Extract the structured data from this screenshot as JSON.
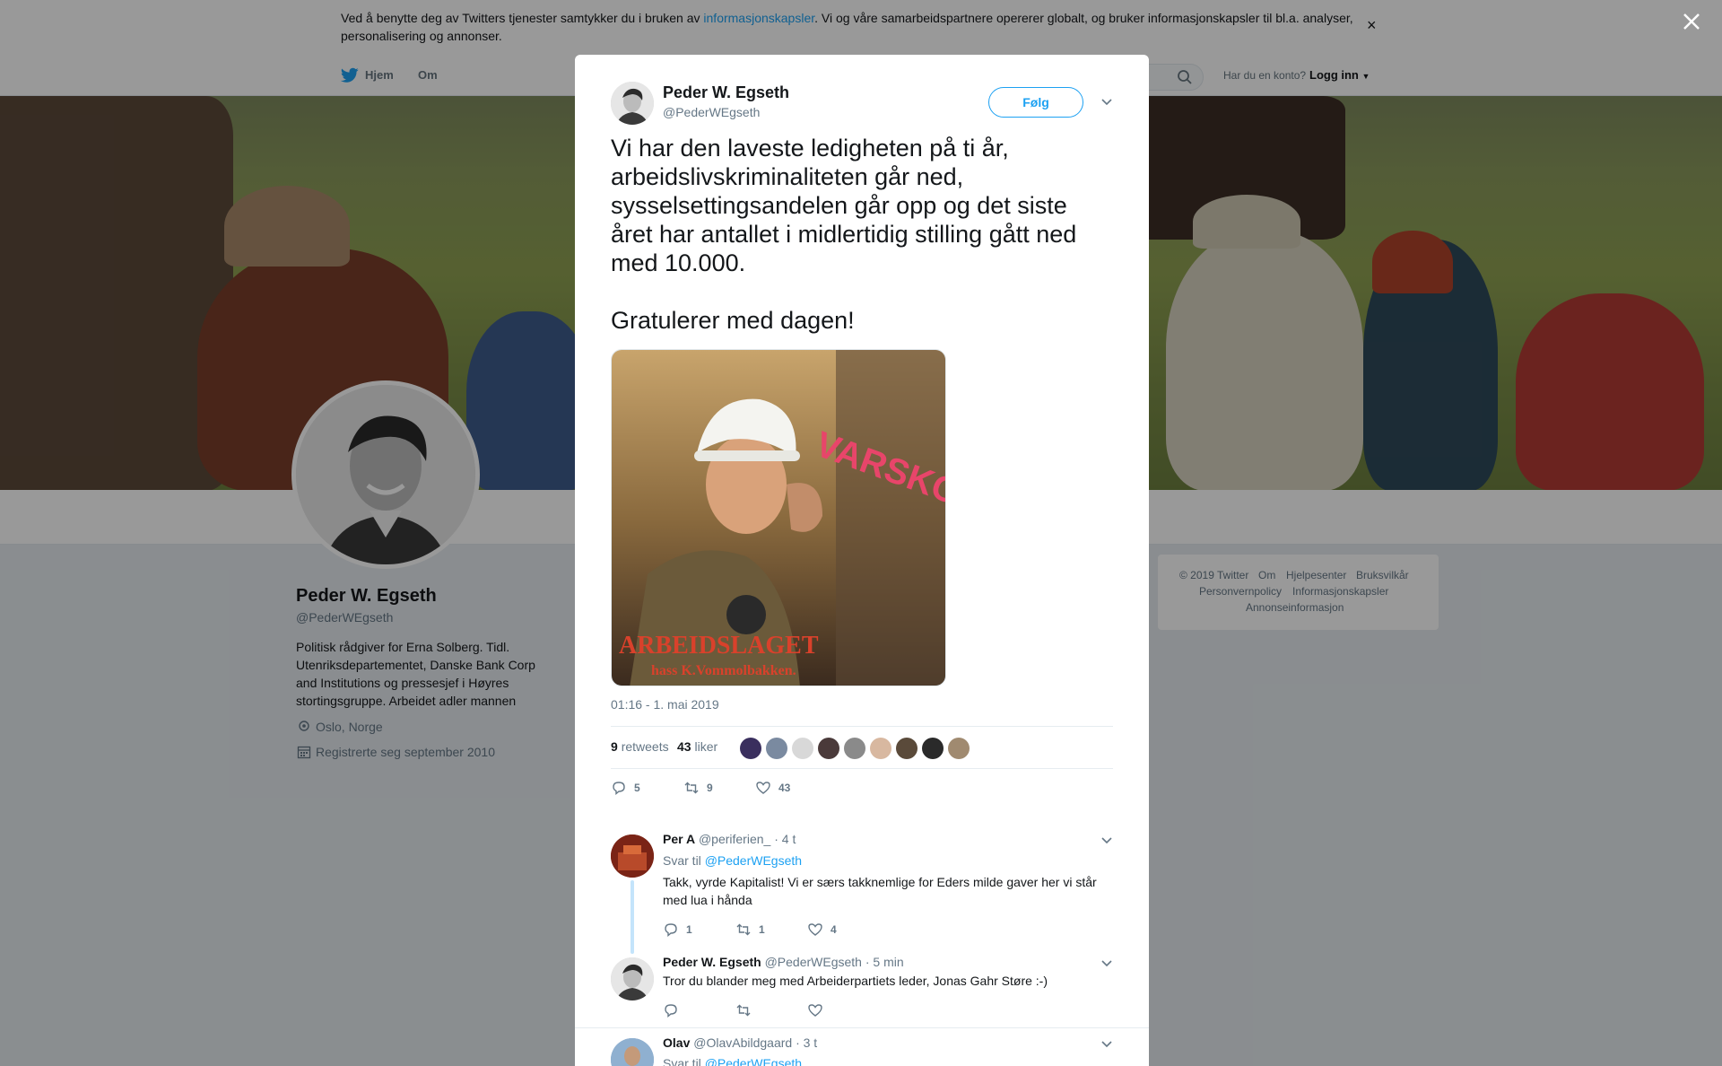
{
  "cookie": {
    "text_before": "Ved å benytte deg av Twitters tjenester samtykker du i bruken av ",
    "link": "informasjonskapsler",
    "text_after": ". Vi og våre samarbeidspartnere opererer globalt, og bruker informasjonskapsler til bl.a. analyser, personalisering og annonser.",
    "close": "×"
  },
  "nav": {
    "home": "Hjem",
    "about": "Om",
    "account_question": "Har du en konto?",
    "login": "Logg inn"
  },
  "profile": {
    "name": "Peder W. Egseth",
    "handle": "@PederWEgseth",
    "bio": "Politisk rådgiver for Erna Solberg. Tidl. Utenriksdepartementet, Danske Bank Corp and Institutions og pressesjef i Høyres stortingsgruppe. Arbeidet adler mannen",
    "location": "Oslo, Norge",
    "joined": "Registrerte seg september 2010"
  },
  "footer": {
    "copyright": "© 2019 Twitter",
    "about": "Om",
    "help": "Hjelpesenter",
    "terms": "Bruksvilkår",
    "privacy": "Personvernpolicy",
    "cookies": "Informasjonskapsler",
    "ads": "Annonseinformasjon"
  },
  "tweet": {
    "name": "Peder W. Egseth",
    "handle": "@PederWEgseth",
    "follow": "Følg",
    "text": "Vi har den laveste ledigheten på ti år, arbeidslivskriminaliteten går ned, sysselsettingsandelen går opp og det siste året har antallet i midlertidig stilling gått ned med 10.000.\n\nGratulerer med dagen!",
    "timestamp": "01:16 - 1. mai 2019",
    "retweets_count": "9",
    "retweets_label": "retweets",
    "likes_count": "43",
    "likes_label": "liker",
    "replies": "5",
    "retweets": "9",
    "likes": "43",
    "image": {
      "headline": "VARSKO HER!",
      "title": "ARBEIDSLAGET",
      "subtitle": "hass K.Vommolbakken."
    }
  },
  "replies": [
    {
      "name": "Per A",
      "handle": "@periferien_",
      "time": "· 4 t",
      "reply_to_label": "Svar til",
      "reply_to": "@PederWEgseth",
      "text": "Takk, vyrde Kapitalist! Vi er særs takknemlige for Eders milde gaver her vi står med lua i hånda",
      "replies": "1",
      "retweets": "1",
      "likes": "4"
    },
    {
      "name": "Peder W. Egseth",
      "handle": "@PederWEgseth",
      "time": "· 5 min",
      "text": "Tror du blander meg med Arbeiderpartiets leder, Jonas Gahr Støre :-)"
    },
    {
      "name": "Olav",
      "handle": "@OlavAbildgaard",
      "time": "· 3 t",
      "reply_to_label": "Svar til",
      "reply_to": "@PederWEgseth"
    }
  ],
  "colors": {
    "accent": "#1da1f2",
    "text_primary": "#14171a",
    "text_secondary": "#657786",
    "overlay": "rgba(0,0,0,0.40)"
  },
  "icons": [
    "twitter-bird-icon",
    "search-icon",
    "location-icon",
    "calendar-icon",
    "reply-icon",
    "retweet-icon",
    "like-icon",
    "chevron-down-icon",
    "close-icon"
  ]
}
